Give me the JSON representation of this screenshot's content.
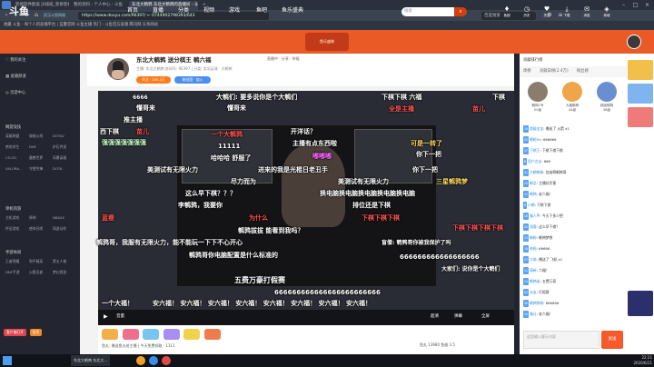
{
  "browser": {
    "tabs": [
      {
        "label": "装修软件欧美 JS排班_装修装修..."
      },
      {
        "label": "我的资料 - 个人中心 - 斗鱼"
      },
      {
        "label": "东北大鹌鹑 东北大鹌鹑的直播间 - 斗..."
      }
    ],
    "url": "https://www.douyu.com/96397/ ← 0744902798393/643",
    "search_label": "百度搜索",
    "bookmarks": "收藏  斗鱼 - 每个人的直播平台  |  蓝蔓官网 斗鱼主播  热门 - 斗鱼官方直播  腾讯网  头条网站"
  },
  "douyu": {
    "logo": "斗鱼",
    "nav": [
      "首页",
      "直播",
      "分类",
      "视频",
      "游戏",
      "鱼吧",
      "鱼乐盛典"
    ],
    "search_placeholder": "搜索",
    "header_icons": [
      {
        "icon": "gift-icon",
        "label": "鱼翅"
      },
      {
        "icon": "history-icon",
        "label": "历史"
      },
      {
        "icon": "follow-icon",
        "label": "关注"
      },
      {
        "icon": "download-icon",
        "label": "下载"
      },
      {
        "icon": "message-icon",
        "label": "消息"
      },
      {
        "icon": "shop-icon",
        "label": "商城"
      }
    ]
  },
  "sidebar": {
    "top_items": [
      "我的关注",
      "直播频道",
      "页游中心"
    ],
    "sections": [
      {
        "head": "网游竞技",
        "items": [
          "英雄联盟",
          "穿越火线",
          "DOTA2",
          "绝地求生",
          "DNF",
          "炉石传说",
          "CS:GO",
          "魔兽世界",
          "风暴英雄",
          "VALORA...",
          "守望先锋",
          "DOTA"
        ]
      },
      {
        "head": "单机热游",
        "items": [
          "主机游戏",
          "原神",
          "NBA2K",
          "怀旧游戏",
          "使命召唤",
          "网游动作"
        ]
      },
      {
        "head": "手游休闲",
        "items": [
          "王者荣耀",
          "和平精英",
          "第五人格",
          "DNF手游",
          "火影忍者",
          "梦幻西游"
        ]
      }
    ],
    "foot_buttons": [
      "客户端打开",
      "鱼秀"
    ]
  },
  "stream": {
    "title": "东北大鹌鹑 送分棋王 鹌六福",
    "subtitle": "主播: 东北大鹌鹑  房间号: 96397  |  分类: 实况足球 · 大鹌鹑",
    "follow": "关注 · 286.3万",
    "fans": "粉丝团 · 加入",
    "top_right": "直播中 · 分享 · 举报"
  },
  "danmaku": [
    "6666",
    "大鹌们: 要多说你是个大鹌们",
    "下棋下棋 六福",
    "下棋",
    "懂哥来",
    "懂哥来",
    "全是主播",
    "推主播",
    "苗儿",
    "西下棋",
    "苗儿",
    "大鹌们 · 说你是个大鹌们",
    "一个大鹌鹑",
    "强强强强强强强",
    "66666666",
    "开洋话？",
    "可是一转了",
    "老子喜了",
    "11111",
    "主播有点东西啦",
    "666",
    "等一等",
    "别吵",
    "你下一把",
    "哈哈哈 舒服了",
    "嘟嘟嘟",
    "美测试有无限火力",
    "进来的我是光棍日老丑手",
    "这么早下棋？？？",
    "尽力而为",
    "三星鹌鹑梦",
    "美测试有无限火力",
    "换电脑换电脑换电脑换电脑换电脑",
    "排位还是下棋",
    "李鹌鹑，我要你",
    "下棋下棋下棋",
    "蓝瘦",
    "为什么",
    "下棋下棋下棋下棋",
    "鹌鹑拔拔 能看到我吗？",
    "盲僧: 鹌鹑哥你被我保护了吗",
    "鹌鹑哥，我服有无限火力，能不能玩一下下不心开心",
    "鹌鹑哥你电脑配置是什么标准的",
    "666666666666666666",
    "五费万豪打假赛",
    "大家们: 说你是个大鹌们",
    "666666666666666666666666",
    "一个大福！",
    "安六福！ 安六福！ 安六福！ 安六福！ 安六福！ 安六福！ 安六福！ 安六福！"
  ],
  "video_controls": {
    "play": "▶",
    "volume": "音量",
    "quality": "超清",
    "danmaku_toggle": "弹幕",
    "fullscreen": "全屏"
  },
  "below_video": {
    "info": "鱼丸: 赠送鱼丸给主播  | 今天免费领取 · 1111",
    "stats": "鱼丸 13980   鱼翅 3.5"
  },
  "chat": {
    "header": "贡献排行榜",
    "tabs": [
      "周榜",
      "贡献日榜(2.4万)",
      "粉丝榜"
    ],
    "ranks": [
      {
        "name": "鹌鹑1号",
        "level": "50级"
      },
      {
        "name": "大福鹌鹑",
        "level": "44级"
      },
      {
        "name": "超级鹌鹑",
        "level": "38级"
      }
    ],
    "lines": [
      {
        "lvl": "19",
        "user": "超级宝宝",
        "text": "赠送了 火箭 x1"
      },
      {
        "lvl": "22",
        "user": "鹌粉00",
        "text": "666666"
      },
      {
        "lvl": "17",
        "user": "下棋王",
        "text": "下棋下棋下棋"
      },
      {
        "lvl": "8",
        "user": "用户点击",
        "text": "666"
      },
      {
        "lvl": "31",
        "user": "大鹌鹑粉",
        "text": "加油啊鹌鹑哥"
      },
      {
        "lvl": "25",
        "user": "鹌总",
        "text": "主播好厉害"
      },
      {
        "lvl": "12",
        "user": "鹌鹑",
        "text": "安六福！"
      },
      {
        "lvl": "9",
        "user": "小鹌",
        "text": "下棋下棋"
      },
      {
        "lvl": "16",
        "user": "路人甲",
        "text": "今天下多少把"
      },
      {
        "lvl": "20",
        "user": "游客",
        "text": "这么早下棋？"
      },
      {
        "lvl": "13",
        "user": "鹌粉",
        "text": "鹌鹑梦想"
      },
      {
        "lvl": "18",
        "user": "老粉",
        "text": "66666"
      },
      {
        "lvl": "27",
        "user": "大佬",
        "text": "赠送了 飞机 x1"
      },
      {
        "lvl": "11",
        "user": "萌新",
        "text": "六福！"
      },
      {
        "lvl": "14",
        "user": "鹌鹑迷",
        "text": "五费万豪"
      },
      {
        "lvl": "23",
        "user": "水友",
        "text": "打假赛"
      },
      {
        "lvl": "30",
        "user": "鹌鹑铁粉",
        "text": "666666"
      },
      {
        "lvl": "10",
        "user": "路过",
        "text": "安六福！"
      }
    ],
    "input_placeholder": "这里输入聊天内容",
    "send": "发送"
  },
  "taskbar": {
    "items": [
      "东北大鹌鹑 东北大...",
      "",
      "",
      "",
      ""
    ],
    "time": "22:21",
    "date": "2020/6/21"
  }
}
